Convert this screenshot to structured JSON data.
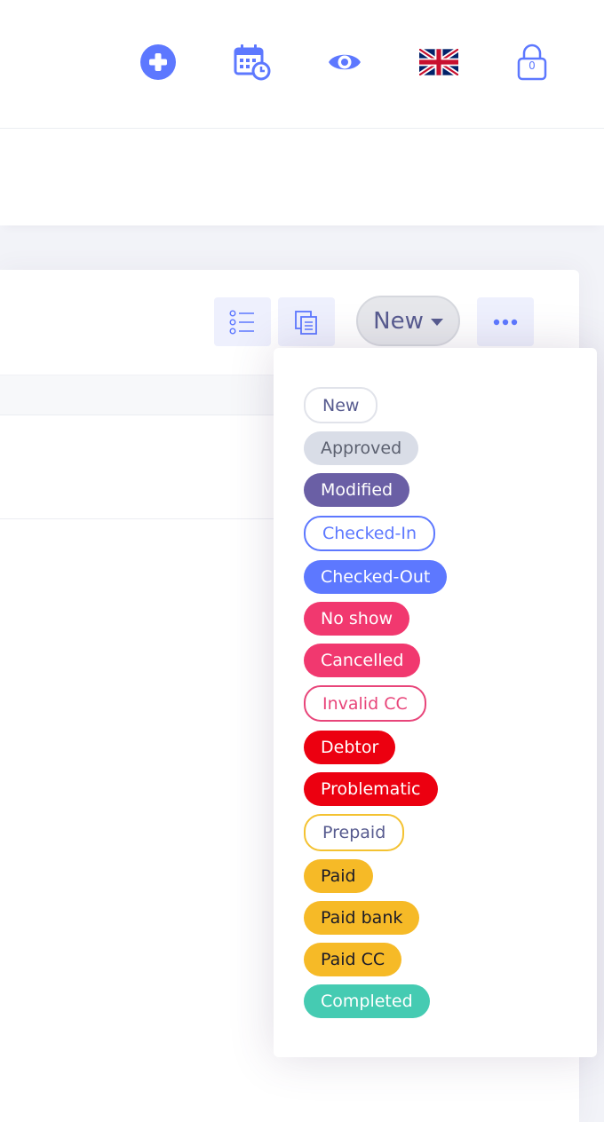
{
  "topbar": {
    "icons": [
      "plus-circle-icon",
      "calendar-clock-icon",
      "eye-icon",
      "uk-flag-icon",
      "lock-icon"
    ],
    "lock_badge": "0"
  },
  "toolbar": {
    "status_label": "New",
    "list_icon": "list-icon",
    "copy_icon": "copy-icon",
    "more_icon": "more-horizontal-icon"
  },
  "status_options": [
    {
      "label": "New"
    },
    {
      "label": "Approved"
    },
    {
      "label": "Modified"
    },
    {
      "label": "Checked-In"
    },
    {
      "label": "Checked-Out"
    },
    {
      "label": "No show"
    },
    {
      "label": "Cancelled"
    },
    {
      "label": "Invalid CC"
    },
    {
      "label": "Debtor"
    },
    {
      "label": "Problematic"
    },
    {
      "label": "Prepaid"
    },
    {
      "label": "Paid"
    },
    {
      "label": "Paid bank"
    },
    {
      "label": "Paid CC"
    },
    {
      "label": "Completed"
    }
  ],
  "colors": {
    "accent": "#5d78ff",
    "modified": "#6a5fa5",
    "danger": "#ec0010",
    "pink": "#f1386f",
    "warning": "#f6ba27",
    "success": "#45cbb2"
  }
}
